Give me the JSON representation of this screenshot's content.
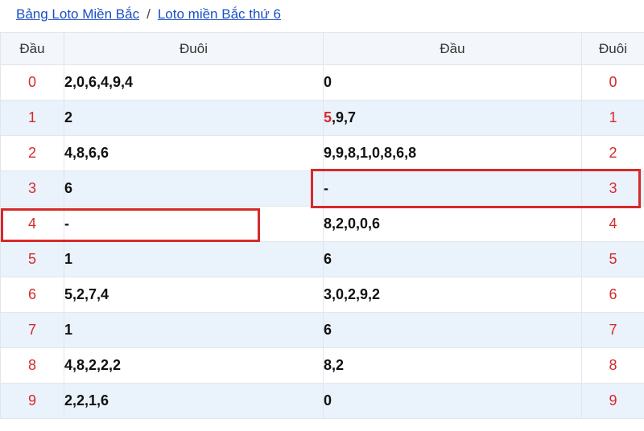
{
  "breadcrumb": {
    "link1": "Bảng Loto Miền Bắc",
    "separator": "/",
    "link2": "Loto miền Bắc thứ 6"
  },
  "table": {
    "headers": [
      "Đầu",
      "Đuôi",
      "Đầu",
      "Đuôi"
    ],
    "rows": [
      {
        "head": "0",
        "tail_list": "2,0,6,4,9,4",
        "head_list": "0",
        "tail": "0"
      },
      {
        "head": "1",
        "tail_list": "2",
        "head_list_red": "5",
        "head_list": ",9,7",
        "tail": "1"
      },
      {
        "head": "2",
        "tail_list": "4,8,6,6",
        "head_list": "9,9,8,1,0,8,6,8",
        "tail": "2"
      },
      {
        "head": "3",
        "tail_list": "6",
        "head_list": "-",
        "tail": "3"
      },
      {
        "head": "4",
        "tail_list": "-",
        "head_list": "8,2,0,0,6",
        "tail": "4"
      },
      {
        "head": "5",
        "tail_list_red": "1",
        "head_list": "6",
        "tail": "5"
      },
      {
        "head": "6",
        "tail_list": "5,2,7,4",
        "head_list": "3,0,2,9,2",
        "tail": "6"
      },
      {
        "head": "7",
        "tail_list": "1",
        "head_list": "6",
        "tail": "7"
      },
      {
        "head": "8",
        "tail_list": "4,8,2,2,2",
        "head_list": "8,2",
        "tail": "8"
      },
      {
        "head": "9",
        "tail_list": "2,2,1,6",
        "head_list": "0",
        "tail": "9"
      }
    ]
  },
  "colors": {
    "accent_red": "#d62a2a",
    "link_blue": "#1a4fc4",
    "alt_row": "#eaf2fb"
  }
}
